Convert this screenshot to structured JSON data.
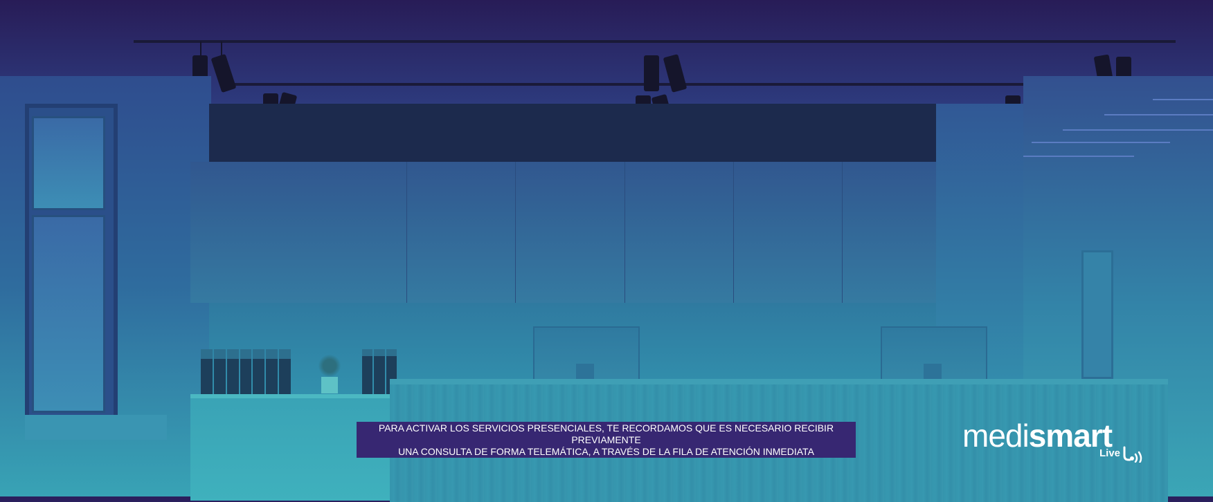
{
  "notice": {
    "line1": "PARA ACTIVAR LOS SERVICIOS PRESENCIALES, TE RECORDAMOS QUE ES NECESARIO RECIBIR PREVIAMENTE",
    "line2": "UNA CONSULTA DE FORMA TELEMÁTICA, A TRAVÉS DE LA FILA DE ATENCIÓN INMEDIATA"
  },
  "logo": {
    "brand_light": "medi",
    "brand_bold": "smart",
    "sub": "Live",
    "icon": "signal-waves-icon"
  },
  "colors": {
    "notice_bg": "#372772",
    "overlay_top": "#2a1e5c",
    "overlay_bottom": "#3aa9b7"
  }
}
